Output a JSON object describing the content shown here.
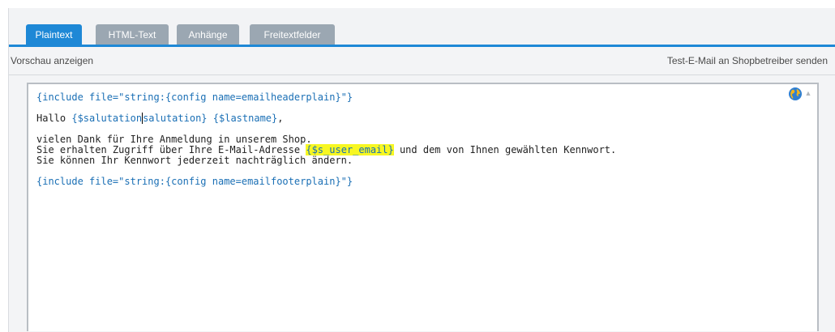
{
  "tabs": [
    {
      "label": "Plaintext",
      "active": true
    },
    {
      "label": "HTML-Text",
      "active": false
    },
    {
      "label": "Anhänge",
      "active": false
    },
    {
      "label": "Freitextfelder",
      "active": false
    }
  ],
  "toolbar": {
    "preview_label": "Vorschau anzeigen",
    "test_mail_label": "Test-E-Mail an Shopbetreiber senden"
  },
  "editor": {
    "line1": "{include file=\"string:{config name=emailheaderplain}\"}",
    "line2_text": "Hallo ",
    "line2_var1": "{$salutation",
    "line2_var1b": "salutation}",
    "line2_sep": " ",
    "line2_var2": "{$lastname}",
    "line2_end": ",",
    "line3": "vielen Dank für Ihre Anmeldung in unserem Shop.",
    "line4_a": "Sie erhalten Zugriff über Ihre E-Mail-Adresse ",
    "line4_hl": "{$s_user_email}",
    "line4_b": " und dem von Ihnen gewählten Kennwort.",
    "line5": "Sie können Ihr Kennwort jederzeit nachträglich ändern.",
    "line6": "{include file=\"string:{config name=emailfooterplain}\"}",
    "icon": "globe-icon",
    "scroll_icon": "scroll-up-arrow-icon"
  },
  "colors": {
    "accent": "#1e88d6",
    "tab_inactive": "#9ba7b2",
    "variable": "#1a6fb5",
    "highlight": "#f7f722"
  }
}
